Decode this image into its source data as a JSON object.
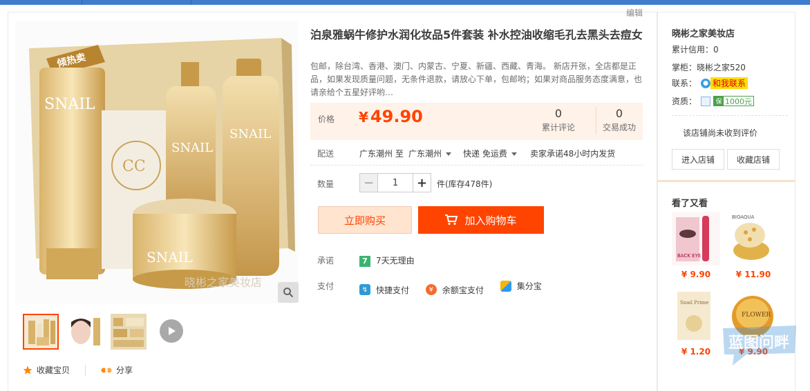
{
  "edit_label": "编辑",
  "main_image": {
    "watermark": "晓彬之家美妆店",
    "badge": "倾热卖",
    "brand": "SNAIL"
  },
  "actions": {
    "favorite_label": "收藏宝贝",
    "share_label": "分享"
  },
  "product": {
    "title": "泊泉雅蜗牛修护水润化妆品5件套装 补水控油收缩毛孔去黑头去痘女",
    "description": "包邮，除台湾、香港、澳门、内蒙古、宁夏、新疆、西藏、青海。 新店开张，全店都是正品，如果发现质量问题，无条件退款，请放心下单，包邮哟；如果对商品服务态度满意，也请亲给个五星好评哟…",
    "price_label": "价格",
    "currency": "¥",
    "price": "49.90",
    "review_count": "0",
    "review_label": "累计评论",
    "sales_count": "0",
    "sales_label": "交易成功",
    "shipping_label": "配送",
    "ship_from": "广东潮州 至",
    "ship_to": "广东潮州",
    "ship_method": "快递 免运费",
    "ship_promise": "卖家承诺48小时内发货",
    "qty_label": "数量",
    "qty_value": "1",
    "stock_text": "件(库存478件)",
    "buy_now": "立即购买",
    "add_cart": "加入购物车",
    "promise_label": "承诺",
    "promise_badge": "7",
    "promise_text": "7天无理由",
    "pay_label": "支付",
    "pay_methods": [
      "快捷支付",
      "余额宝支付",
      "集分宝"
    ]
  },
  "shop": {
    "name": "晓彬之家美妆店",
    "credit_label": "累计信用：",
    "credit_value": "0",
    "owner_label": "掌柜：",
    "owner_value": "晓彬之家520",
    "contact_label": "联系：",
    "contact_text": "和我联系",
    "qualification_label": "资质：",
    "qualification_value": "1000元",
    "no_reviews": "该店铺尚未收到评价",
    "enter_shop": "进入店铺",
    "fav_shop": "收藏店铺"
  },
  "recommend": {
    "heading": "看了又看",
    "items": [
      {
        "price": "¥ 9.90",
        "label": "BACK EYE"
      },
      {
        "price": "¥ 11.90",
        "label": "BIOAQUA"
      },
      {
        "price": "¥ 1.20",
        "label": "Snail Prime"
      },
      {
        "price": "¥ 9.90",
        "label": "FLOWER"
      }
    ]
  },
  "watermark_text": "蓝图问畔",
  "colors": {
    "accent": "#ff4400",
    "top_bar": "#3e7ecd",
    "price_bg": "#fff2e8"
  }
}
